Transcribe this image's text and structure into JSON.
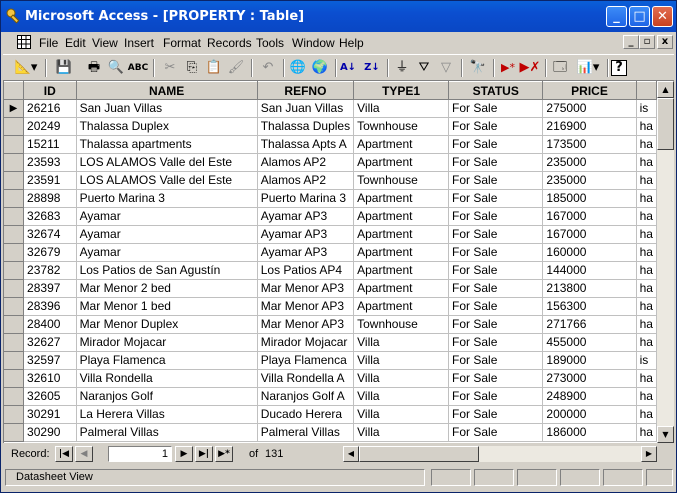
{
  "window": {
    "title": "Microsoft Access - [PROPERTY : Table]",
    "controls": {
      "minimize": "_",
      "maximize": "□",
      "close": "✕"
    }
  },
  "menu": {
    "items": [
      "File",
      "Edit",
      "View",
      "Insert",
      "Format",
      "Records",
      "Tools",
      "Window",
      "Help"
    ],
    "mdi": {
      "minimize": "_",
      "restore": "🗗",
      "close": "x"
    }
  },
  "toolbar": {
    "icons": [
      "view-icon",
      "save-icon",
      "print-icon",
      "print-preview-icon",
      "spelling-icon",
      "cut-icon",
      "copy-icon",
      "paste-icon",
      "format-painter-icon",
      "undo-icon",
      "insert-hyperlink-icon",
      "web-toolbar-icon",
      "sort-ascending-icon",
      "sort-descending-icon",
      "filter-by-selection-icon",
      "filter-by-form-icon",
      "apply-filter-icon",
      "find-icon",
      "new-record-icon",
      "delete-record-icon",
      "database-window-icon",
      "new-object-icon",
      "help-icon"
    ]
  },
  "table": {
    "columns": [
      "ID",
      "NAME",
      "REFNO",
      "TYPE1",
      "STATUS",
      "PRICE",
      ""
    ],
    "rows": [
      [
        "26216",
        "San Juan Villas",
        "San Juan Villas",
        "Villa",
        "For Sale",
        "275000",
        "is"
      ],
      [
        "20249",
        "Thalassa Duplex",
        "Thalassa Duples",
        "Townhouse",
        "For Sale",
        "216900",
        "ha"
      ],
      [
        "15211",
        "Thalassa apartments",
        "Thalassa Apts A",
        "Apartment",
        "For Sale",
        "173500",
        "ha"
      ],
      [
        "23593",
        "LOS ALAMOS Valle del Este",
        "Alamos AP2",
        "Apartment",
        "For Sale",
        "235000",
        "ha"
      ],
      [
        "23591",
        "LOS ALAMOS Valle del Este",
        "Alamos  AP2",
        "Townhouse",
        "For Sale",
        "235000",
        "ha"
      ],
      [
        "28898",
        "Puerto Marina 3",
        "Puerto Marina 3",
        "Apartment",
        "For Sale",
        "185000",
        "ha"
      ],
      [
        "32683",
        "Ayamar",
        "Ayamar AP3",
        "Apartment",
        "For Sale",
        "167000",
        "ha"
      ],
      [
        "32674",
        "Ayamar",
        "Ayamar AP3",
        "Apartment",
        "For Sale",
        "167000",
        "ha"
      ],
      [
        "32679",
        "Ayamar",
        "Ayamar AP3",
        "Apartment",
        "For Sale",
        "160000",
        "ha"
      ],
      [
        "23782",
        "Los Patios de San Agustín",
        "Los Patios AP4",
        "Apartment",
        "For Sale",
        "144000",
        "ha"
      ],
      [
        "28397",
        "Mar Menor 2 bed",
        "Mar Menor AP3",
        "Apartment",
        "For Sale",
        "213800",
        "ha"
      ],
      [
        "28396",
        "Mar Menor 1 bed",
        "Mar Menor AP3",
        "Apartment",
        "For Sale",
        "156300",
        "ha"
      ],
      [
        "28400",
        "Mar Menor Duplex",
        "Mar Menor AP3",
        "Townhouse",
        "For Sale",
        "271766",
        "ha"
      ],
      [
        "32627",
        "Mirador Mojacar",
        "Mirador Mojacar",
        "Villa",
        "For Sale",
        "455000",
        "ha"
      ],
      [
        "32597",
        "Playa Flamenca",
        "Playa Flamenca",
        "Villa",
        "For Sale",
        "189000",
        "is"
      ],
      [
        "32610",
        "Villa Rondella",
        "Villa Rondella A",
        "Villa",
        "For Sale",
        "273000",
        "ha"
      ],
      [
        "32605",
        "Naranjos Golf",
        "Naranjos Golf A",
        "Villa",
        "For Sale",
        "248900",
        "ha"
      ],
      [
        "30291",
        "La Herera Villas",
        "Ducado Herera",
        "Villa",
        "For Sale",
        "200000",
        "ha"
      ],
      [
        "30290",
        "Palmeral Villas",
        "Palmeral Villas",
        "Villa",
        "For Sale",
        "186000",
        "ha"
      ]
    ],
    "current_row_marker": "▶"
  },
  "navigation": {
    "label": "Record:",
    "current": "1",
    "of_label": "of",
    "total": "131",
    "first": "|◀",
    "prev": "◀",
    "next": "▶",
    "last": "▶|",
    "new": "▶*"
  },
  "status": {
    "text": "Datasheet View"
  },
  "colors": {
    "title_bar": "#0b4ed0",
    "chrome": "#d4d0c8"
  }
}
